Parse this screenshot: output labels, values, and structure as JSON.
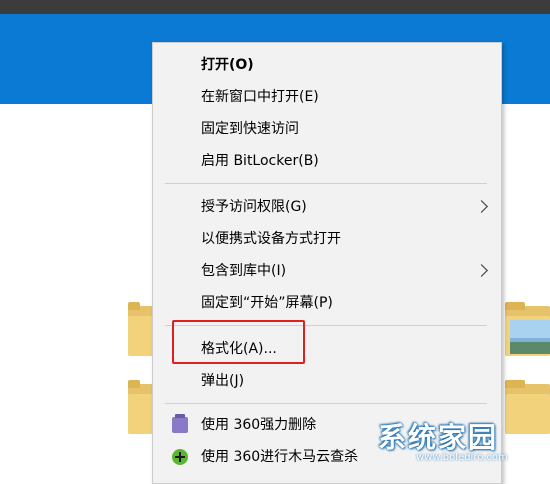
{
  "context_menu": {
    "items": [
      {
        "label": "打开(O)"
      },
      {
        "label": "在新窗口中打开(E)"
      },
      {
        "label": "固定到快速访问"
      },
      {
        "label": "启用 BitLocker(B)"
      },
      {
        "label": "授予访问权限(G)"
      },
      {
        "label": "以便携式设备方式打开"
      },
      {
        "label": "包含到库中(I)"
      },
      {
        "label": "固定到“开始”屏幕(P)"
      },
      {
        "label": "格式化(A)..."
      },
      {
        "label": "弹出(J)"
      },
      {
        "label": "使用 360强力删除"
      },
      {
        "label": "使用 360进行木马云查杀"
      }
    ]
  },
  "watermark": {
    "text": "系统家园",
    "url": "www.bolediro.com"
  },
  "colors": {
    "highlight": "#e02020",
    "accent": "#0a7ad4"
  }
}
